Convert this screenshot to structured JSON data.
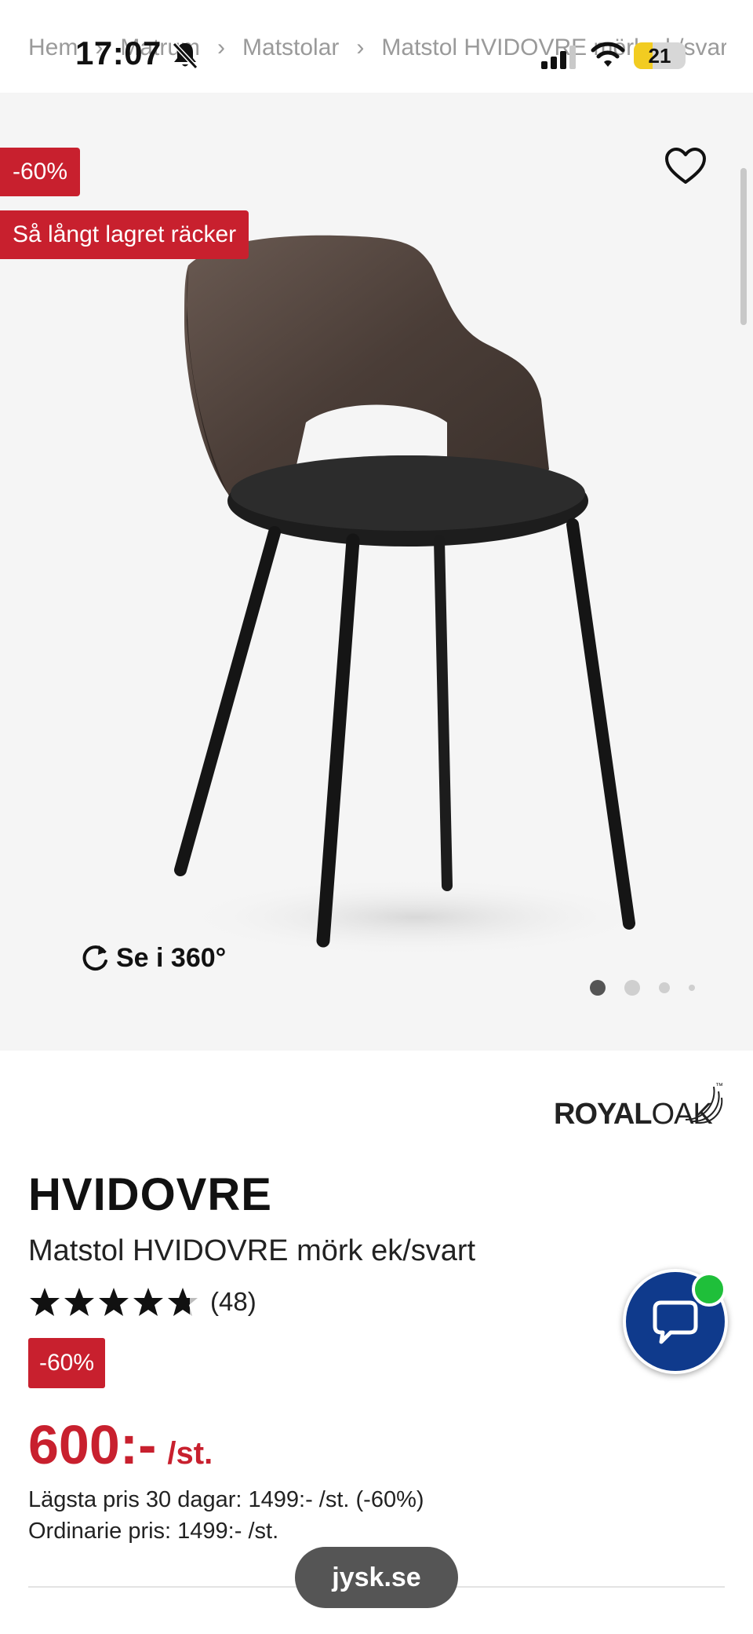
{
  "status_bar": {
    "time": "17:07",
    "battery_level": "21",
    "icons": [
      "bell-muted-icon",
      "signal-icon",
      "wifi-icon",
      "battery-icon"
    ]
  },
  "breadcrumb": [
    "Hem",
    "Matrum",
    "Matstolar",
    "Matstol HVIDOVRE mörk ek/svart"
  ],
  "gallery": {
    "discount_badge": "-60%",
    "stock_badge": "Så långt lagret räcker",
    "view_360_label": "Se i 360°",
    "image_count": 4,
    "active_image_index": 0,
    "wishlist_icon": "heart-outline-icon"
  },
  "brand": {
    "name_bold": "ROYAL",
    "name_light": "OAK",
    "trademark": "™"
  },
  "product": {
    "name": "HVIDOVRE",
    "description": "Matstol HVIDOVRE mörk ek/svart",
    "rating_value": 4.5,
    "rating_count": "(48)",
    "price_badge": "-60%",
    "price": "600:-",
    "price_unit": "/st.",
    "lowest_price": "Lägsta pris 30 dagar: 1499:- /st. (-60%)",
    "ordinary_price": "Ordinarie pris: 1499:- /st."
  },
  "chat": {
    "icon": "chat-bubble-icon",
    "online": true
  },
  "browser": {
    "url": "jysk.se"
  },
  "colors": {
    "sale_red": "#c8202e",
    "chat_blue": "#0f3a8c",
    "online_green": "#1fbf3a",
    "gallery_bg": "#f5f5f5"
  }
}
